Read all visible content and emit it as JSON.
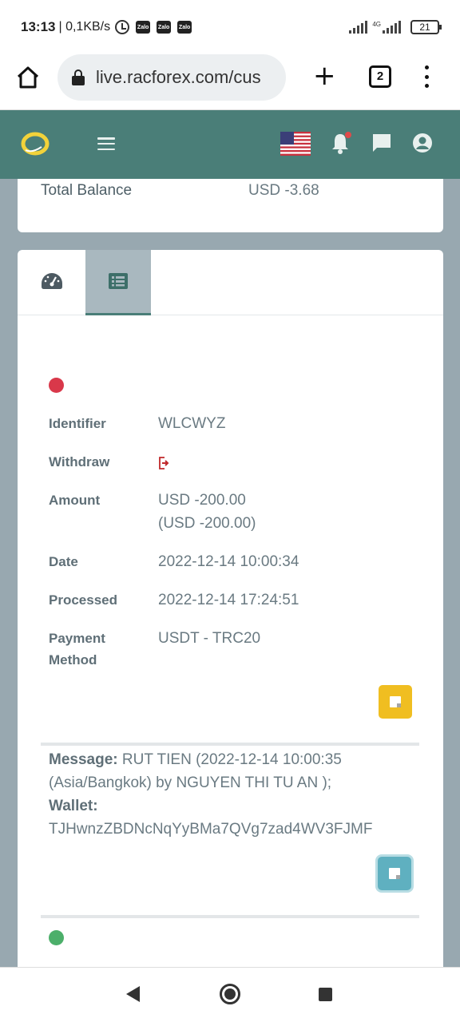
{
  "status_bar": {
    "time": "13:13",
    "network_speed": "| 0,1KB/s",
    "notification_apps": [
      "Zalo",
      "Zalo",
      "Zalo"
    ],
    "network_type": "4G",
    "battery": "21"
  },
  "browser": {
    "url": "live.racforex.com/cus",
    "tab_count": "2"
  },
  "app_header": {
    "brand_color": "#4a7e78",
    "icons": [
      "hamburger-menu-icon",
      "us-flag-icon",
      "bell-icon",
      "chat-icon",
      "user-account-icon"
    ]
  },
  "balance_card": {
    "label": "Total Balance",
    "value": "USD -3.68"
  },
  "transaction_tabs": {
    "tabs": [
      "dashboard-gauge-icon",
      "list-icon"
    ],
    "active_index": 1
  },
  "transaction": {
    "status_color": "#d9384a",
    "fields": {
      "identifier_label": "Identifier",
      "identifier_value": "WLCWYZ",
      "type_label": "Withdraw",
      "amount_label": "Amount",
      "amount_value": "USD -200.00",
      "amount_converted": "(USD -200.00)",
      "date_label": "Date",
      "date_value": "2022-12-14 10:00:34",
      "processed_label": "Processed",
      "processed_value": "2022-12-14 17:24:51",
      "payment_label_1": "Payment",
      "payment_label_2": "Method",
      "payment_value": "USDT - TRC20"
    },
    "message_label": "Message:",
    "message_text": "RUT TIEN (2022-12-14 10:00:35 (Asia/Bangkok) by NGUYEN THI TU AN );",
    "wallet_label": "Wallet:",
    "wallet_value": "TJHwnzZBDNcNqYyBMa7QVg7zad4WV3FJMF"
  },
  "next_transaction": {
    "status_color": "#4caf6a"
  }
}
